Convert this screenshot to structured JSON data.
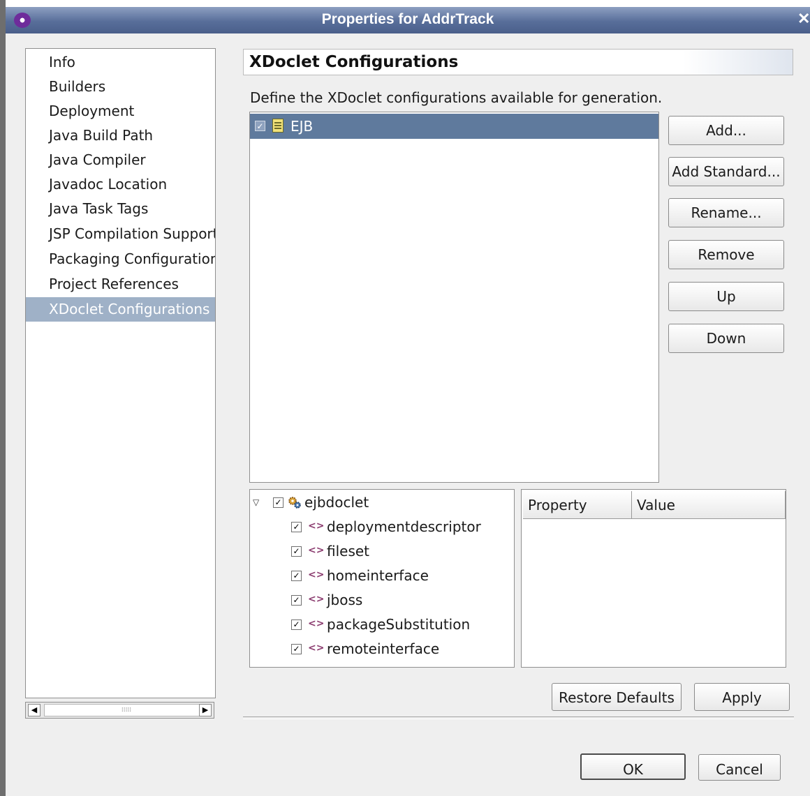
{
  "window": {
    "title": "Properties for AddrTrack",
    "icon": "eclipse-icon",
    "close_icon": "close-icon"
  },
  "nav": {
    "items": [
      {
        "label": "Info"
      },
      {
        "label": "Builders"
      },
      {
        "label": "Deployment"
      },
      {
        "label": "Java Build Path"
      },
      {
        "label": "Java Compiler"
      },
      {
        "label": "Javadoc Location"
      },
      {
        "label": "Java Task Tags"
      },
      {
        "label": "JSP Compilation Support"
      },
      {
        "label": "Packaging Configurations"
      },
      {
        "label": "Project References"
      },
      {
        "label": "XDoclet Configurations"
      }
    ],
    "selected": "XDoclet Configurations",
    "scroll": {
      "left_arrow": "◀",
      "right_arrow": "▶",
      "thumb_grip": "⁞⁞⁞⁞⁞"
    }
  },
  "page": {
    "header": "XDoclet Configurations",
    "description": "Define the XDoclet configurations available for generation."
  },
  "configurations": {
    "items": [
      {
        "label": "EJB",
        "checked": true,
        "selected": true,
        "icon": "config-file-icon"
      }
    ]
  },
  "buttons": {
    "add": "Add...",
    "add_standard": "Add Standard...",
    "rename": "Rename...",
    "remove": "Remove",
    "up": "Up",
    "down": "Down",
    "restore_defaults": "Restore Defaults",
    "apply": "Apply",
    "ok": "OK",
    "cancel": "Cancel"
  },
  "doclet_tree": {
    "root": {
      "label": "ejbdoclet",
      "checked": true,
      "expanded": true,
      "icon": "gear-icon"
    },
    "children": [
      {
        "label": "deploymentdescriptor",
        "checked": true
      },
      {
        "label": "fileset",
        "checked": true
      },
      {
        "label": "homeinterface",
        "checked": true
      },
      {
        "label": "jboss",
        "checked": true
      },
      {
        "label": "packageSubstitution",
        "checked": true
      },
      {
        "label": "remoteinterface",
        "checked": true
      }
    ]
  },
  "property_table": {
    "columns": [
      "Property",
      "Value"
    ],
    "rows": []
  },
  "colors": {
    "selection": "#9fb1c7",
    "list_selection": "#5f7a9d",
    "titlebar": "#586e9a"
  }
}
